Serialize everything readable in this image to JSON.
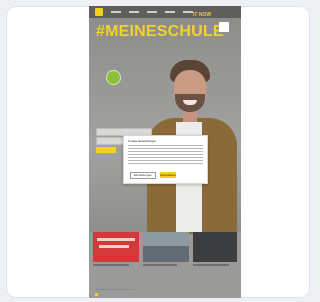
{
  "headline": "#MEINESCHULE",
  "cookie_modal": {
    "title": "Cookie-Einstellungen",
    "settings_label": "Einstellungen",
    "accept_label": "Akzeptieren"
  },
  "tiles": {
    "third_label": "IT NOW"
  },
  "colors": {
    "accent": "#f2d21d",
    "dark_nav": "#5e5e5d",
    "green_badge": "#8dbf3a",
    "red_tile": "#d3393a"
  },
  "icons": [
    "logo-icon",
    "green-badge-icon"
  ]
}
